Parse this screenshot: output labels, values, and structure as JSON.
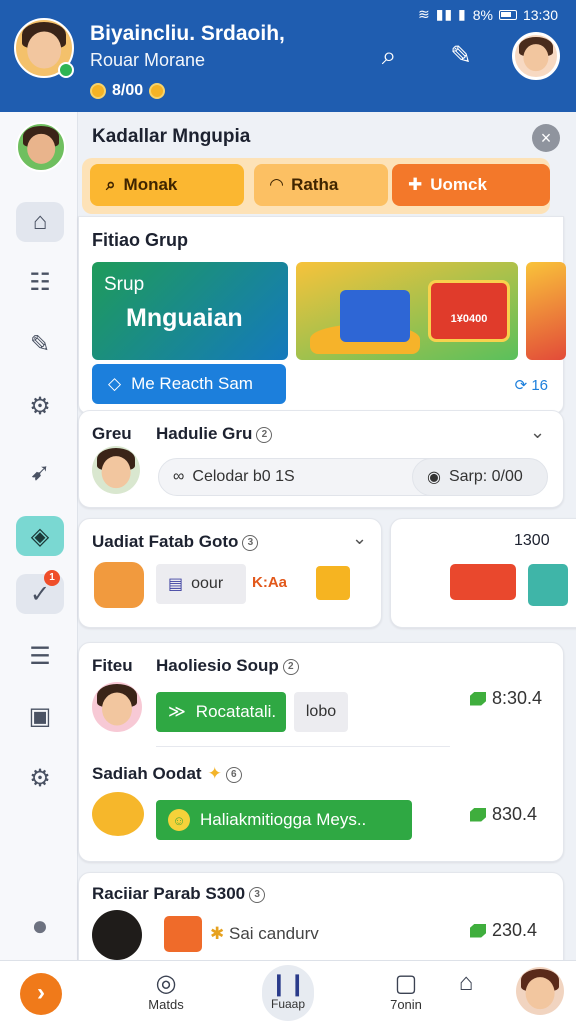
{
  "status": {
    "battery": "8%",
    "time": "13:30"
  },
  "header": {
    "title": "Biyaincliu. Srdaoih,",
    "subtitle": "Rouar Morane",
    "coins": "8/00"
  },
  "panel": {
    "title": "Kadallar Mngupia"
  },
  "actions": [
    {
      "label": "Monak",
      "icon": "search-icon"
    },
    {
      "label": "Ratha",
      "icon": "wave-icon"
    },
    {
      "label": "Uomck",
      "icon": "plus-icon"
    }
  ],
  "featured": {
    "title": "Fitiao Grup",
    "promo1_line1": "Srup",
    "promo1_line2": "Mnguaian",
    "promo2_sign": "1¥0400",
    "button": "Me Reacth Sam",
    "link": "16"
  },
  "group1": {
    "label": "Greu",
    "name": "Hadulie Gru",
    "field1": "Celodar b0 1S",
    "field2": "Sarp: 0/00"
  },
  "group2": {
    "name": "Uadiat Fatab Goto",
    "side_value": "1300",
    "tag": "oour",
    "tag2": "K:Aa"
  },
  "group3": {
    "label": "Fiteu",
    "name": "Haoliesio Soup",
    "btn_green": "Rocatatali.",
    "btn_grey": "lobo",
    "amount": "8:30.4"
  },
  "group4": {
    "name": "Sadiah Oodat",
    "btn_green": "Haliakmitiogga Meys..",
    "amount": "830.4"
  },
  "group5": {
    "name": "Raciiar Parab S300",
    "caption": "Sai candurv",
    "amount": "230.4"
  },
  "bottom_nav": {
    "item1": "Matds",
    "center": "Fuaap",
    "item3": "7onin",
    "notif": "1"
  },
  "colors": {
    "header": "#1f5db0",
    "accent": "#f07a1a",
    "green": "#2fa843"
  }
}
